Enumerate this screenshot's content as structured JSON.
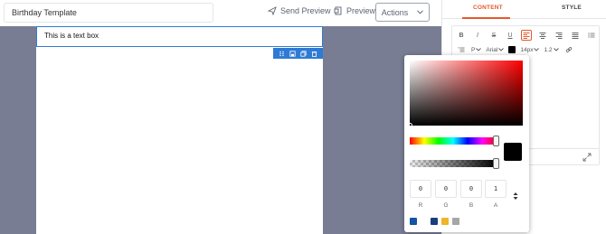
{
  "header": {
    "template_name": "Birthday Template",
    "send_preview_label": "Send Preview",
    "preview_label": "Preview",
    "actions_label": "Actions"
  },
  "canvas": {
    "text_box_content": "This is a text box"
  },
  "panel": {
    "tabs": [
      {
        "label": "CONTENT",
        "active": true
      },
      {
        "label": "STYLE",
        "active": false
      }
    ],
    "toolbar": {
      "paragraph_select": "P",
      "font_select": "Arial",
      "font_size_select": "14px",
      "line_height_select": "1.2"
    }
  },
  "color_picker": {
    "rgba": {
      "r": "0",
      "g": "0",
      "b": "0",
      "a": "1"
    },
    "labels": {
      "r": "R",
      "g": "G",
      "b": "B",
      "a": "A"
    },
    "presets": [
      "#1155a3",
      "#1a3f7a",
      "#f0b429",
      "#a6a6a6"
    ]
  },
  "colors": {
    "accent": "#e35a2e",
    "selection": "#2f7bd4",
    "canvas_bg": "#787d94"
  }
}
